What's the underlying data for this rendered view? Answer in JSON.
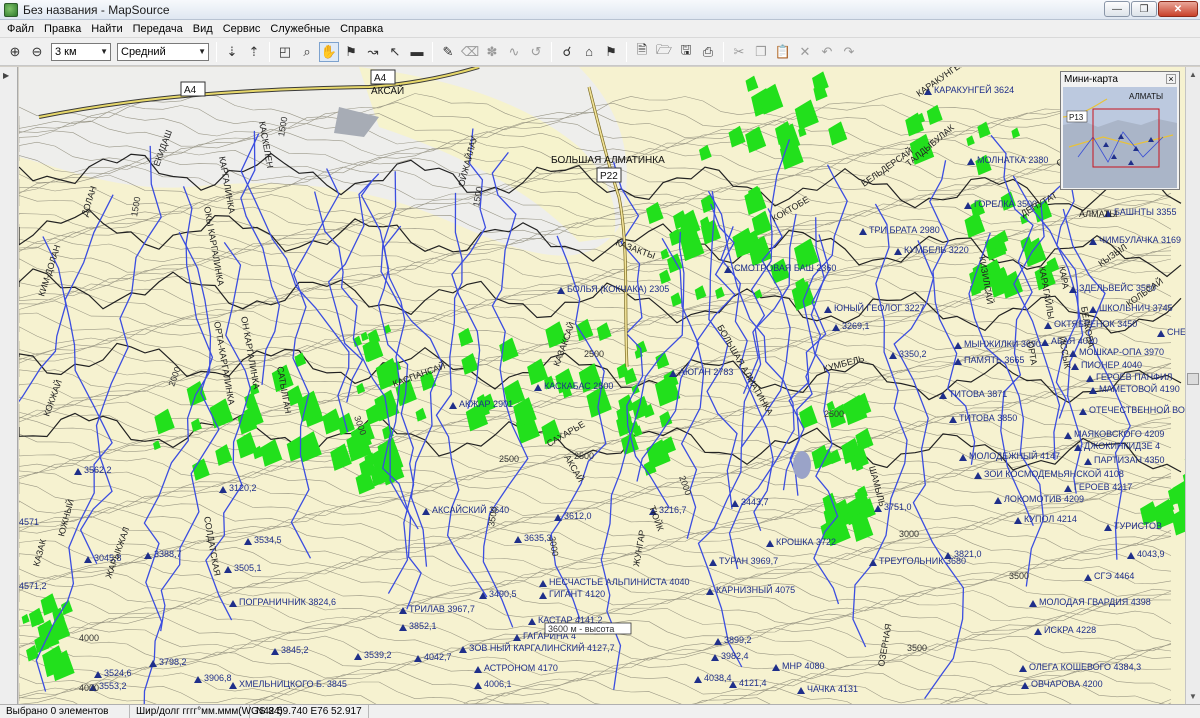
{
  "window": {
    "title": "Без названия - MapSource"
  },
  "menu": [
    "Файл",
    "Правка",
    "Найти",
    "Передача",
    "Вид",
    "Сервис",
    "Служебные",
    "Справка"
  ],
  "toolbar": {
    "scale_value": "3 км",
    "detail_value": "Средний"
  },
  "minimap": {
    "title": "Мини-карта",
    "labels": [
      "АЛМАТЫ",
      "P13"
    ]
  },
  "map": {
    "roads": [
      "A4",
      "A4",
      "P22"
    ],
    "places": [
      "БОЛЬШАЯ АЛМАТИНКА",
      "АКСАЙ"
    ],
    "peaks": [
      "КАРАКУНГЕЙ 3624",
      "МОЛНАТКА 2380",
      "ГОРЕЛКА 3500",
      "БАШНТЫ 3355",
      "ЧИМБУЛАЧКА 3169",
      "ТРИ БРАТА 2980",
      "КУМБЕЛЬ 3220",
      "СМОТРОВАЯ БАШ 2360",
      "БОЛЬЯ (КОКЧАКА) 2305",
      "ЗДЕЛЬВЕЙС 3550",
      "ШКОЛЬНИЧ 3745",
      "ЮНЫЙ ГЕОЛОГ 3227",
      "ОКТЯБРЕНОК 3450",
      "СНЕЖНО",
      "АБАЯ 4010",
      "МЫНЖИЛКИ 3690",
      "ПАМЯТЬ 3665",
      "МОШКАР-ОПА 3970",
      "ПИОНЕР 4040",
      "ГЕРОЕВ ПАНФИЛ",
      "МАМЕТОВОЙ 4190",
      "ТИТОВА 3871",
      "ТИТОВА 3850",
      "ОТЕЧЕСТВЕННОЙ ВОЙНЫ",
      "КАСКАБАС 2800",
      "АЮГАН 2783",
      "АКЖАР 2901",
      "МАЯКОВСКОГО 4209",
      "ДЖОКИНКИДЗЕ 4",
      "ПАРТИЗАН 4350",
      "МОЛОДЕЖНЫЙ 4147",
      "ЗОИ КОСМОДЕМЬЯНСКОЙ 4108",
      "ЛОКОМОТИВ 4209",
      "ГЕРОЕВ 4217",
      "КУПОЛ 4214",
      "ТУРИСТОВ",
      "АКСАЙСКИЙ 3640",
      "КРОШКА 3722",
      "ТУРАН 3969,7",
      "ТРЕУГОЛЬНИК 3680",
      "НЕСЧАСТЬЕ АЛЬПИНИСТА 4040",
      "КАРНИЗНЫЙ 4075",
      "ГИГАНТ 4120",
      "ПОГРАНИЧНИК 3824,6",
      "ТРИЛАВ 3967,7",
      "КАСТАР 4141,2",
      "ГАГАРИНА 4",
      "ЗОВ НЫЙ КАРГАЛИНСКИЙ 4127,7",
      "МОЛОДАЯ ГВАРДИЯ 4398",
      "ИСКРА 4228",
      "СГЭ 4464",
      "АСТРОНОМ 4170",
      "МНР 4080",
      "ОЛЕГА КОШЕВОГО 4384,3",
      "ОВЧАРОВА 4200",
      "ЧАЧКА 4131",
      "ХМЕЛЬНИЦКОГО Б. 3845",
      "3562,2",
      "3120,2",
      "3612,0",
      "3216,7",
      "3443,7",
      "3751,0",
      "3635,3",
      "3534,5",
      "3388,7",
      "3505,1",
      "3045,8",
      "3490,5",
      "3852,1",
      "3845,2",
      "3539,2",
      "4042,7",
      "4006,1",
      "3899,2",
      "3982,4",
      "4038,4",
      "4121,4",
      "3821,0",
      "4043,9",
      "3798,2",
      "3906,8",
      "3524,6",
      "3553,2",
      "3269,1",
      "3350,2",
      "4571",
      "4571,2"
    ],
    "valleys": [
      "КИМ-ДОЛАН",
      "ДОЛАН",
      "ЕКИДАШ",
      "КАРГАЛИНКА",
      "КАСКЕЛЕН",
      "ОКЫ КАРГАЛИНКА",
      "ОРТА-КАРГАЛИНКА",
      "ОН КАРГАЛИНКА",
      "САТЫЛГАН",
      "ОЙЖАЙЛАУ",
      "КАСПАНСАЙ",
      "КАЗАКТЫ",
      "КАЗАКСАЙ",
      "КОКЖАЙ",
      "КАЗАК",
      "БОЛЬШАЯ АЛМАТИНКА",
      "ТАЛДЫБУЛАК",
      "КОКТОБЕ",
      "САХАРЬЕ",
      "АКСАЙ",
      "ЮЖНЫЙ",
      "ШАМЫЛЬ",
      "СОЛДАТСКАЯ",
      "КАРАКУНГЕЙ",
      "ДЕПУТАТ",
      "КИЗИЛСАЙ",
      "БЕЛЬДЕРСАЙ",
      "ОЗЕРНАЯ",
      "ЖУНГАР",
      "ЖАРЫКЖАЛ",
      "ТЮЙК",
      "ТЕРРАСНАЯ",
      "ЗАПАДНАЯ",
      "КАРАГАЙЛЫ",
      "ИССЫК",
      "КУМБЕЛЬ",
      "БЕЛКОВА",
      "ОРТА",
      "КАРА",
      "САРЫСАЙ",
      "АМАНДЫ",
      "АЛМАТЫ",
      "КЫЗЫЛ",
      "КОЛЬСАЙ"
    ],
    "elevations": [
      "1500",
      "1500",
      "1500",
      "2000",
      "2000",
      "2500",
      "2500",
      "2500",
      "2500",
      "3000",
      "3000",
      "3000",
      "3500",
      "3500",
      "3500",
      "4000",
      "4000"
    ],
    "scale_bar": "3600 м - высота"
  },
  "status": {
    "selected": "Выбрано 0 элементов",
    "format": "Шир/долг гггг°мм.ммм(WGS 84)",
    "coords": "N42 59.740 E76 52.917"
  }
}
